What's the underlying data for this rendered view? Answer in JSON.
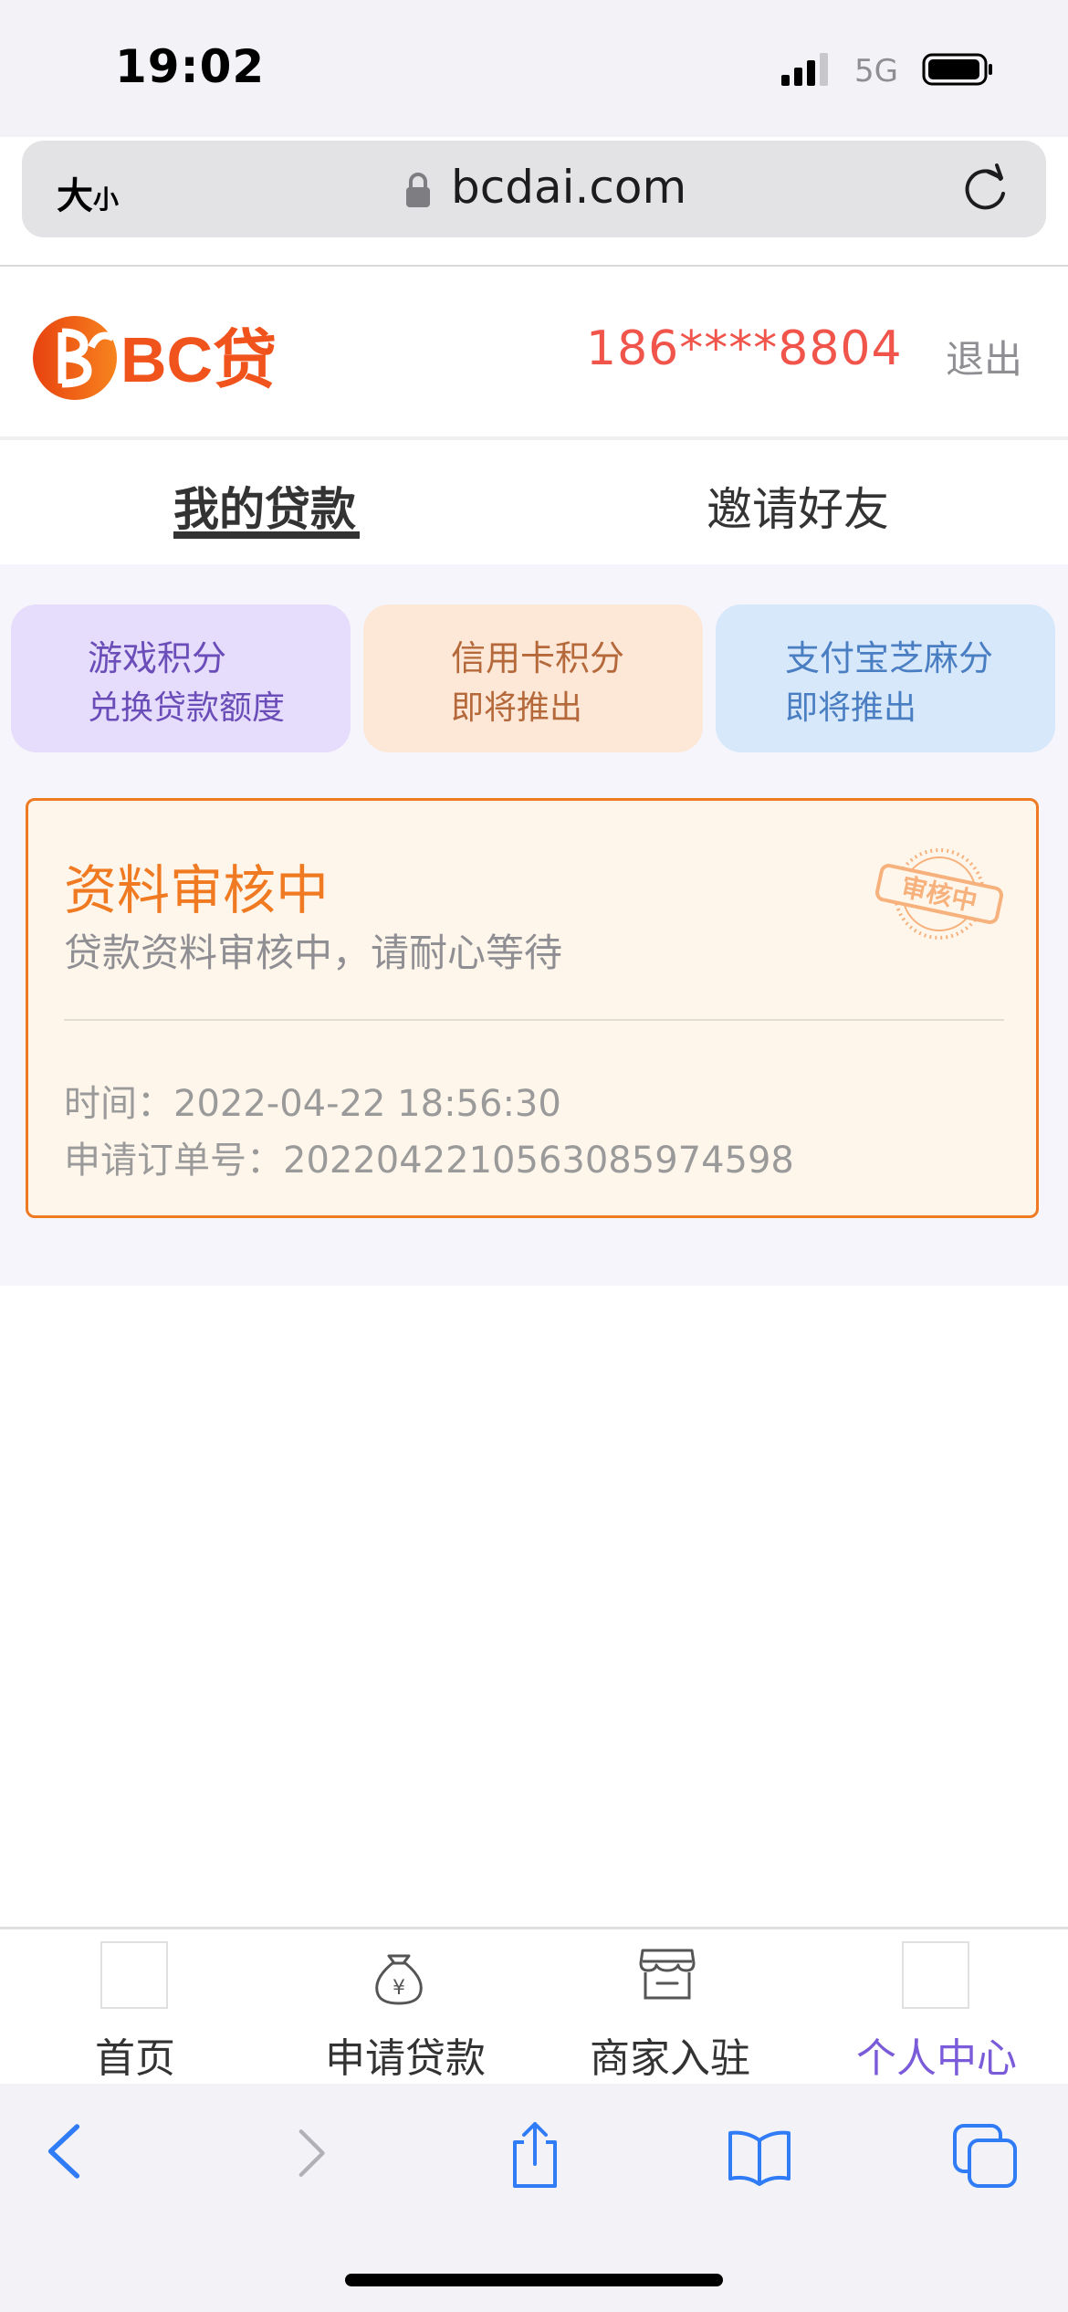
{
  "status_bar": {
    "time": "19:02",
    "network": "5G"
  },
  "browser": {
    "text_size_big": "大",
    "text_size_small": "小",
    "domain": "bcdai.com"
  },
  "header": {
    "logo_text": "BC贷",
    "phone": "186****8804",
    "logout": "退出"
  },
  "tabs": [
    {
      "label": "我的贷款",
      "active": true
    },
    {
      "label": "邀请好友",
      "active": false
    }
  ],
  "promo_cards": [
    {
      "line1": "游戏积分",
      "line2": "兑换贷款额度"
    },
    {
      "line1": "信用卡积分",
      "line2": "即将推出"
    },
    {
      "line1": "支付宝芝麻分",
      "line2": "即将推出"
    }
  ],
  "status_card": {
    "title": "资料审核中",
    "subtitle": "贷款资料审核中，请耐心等待",
    "stamp_text": "审核中",
    "time_label": "时间：",
    "time_value": "2022-04-22 18:56:30",
    "order_label": "申请订单号：",
    "order_value": "20220422105630859745​98"
  },
  "bottom_nav": [
    {
      "label": "首页",
      "icon": "home-placeholder-icon"
    },
    {
      "label": "申请贷款",
      "icon": "money-bag-icon"
    },
    {
      "label": "商家入驻",
      "icon": "store-icon"
    },
    {
      "label": "个人中心",
      "icon": "profile-placeholder-icon",
      "active": true
    }
  ],
  "colors": {
    "brand_orange": "#f07a22",
    "phone_red": "#f0544a",
    "nav_active": "#7a5bd9",
    "ios_blue": "#2f7cf6"
  }
}
